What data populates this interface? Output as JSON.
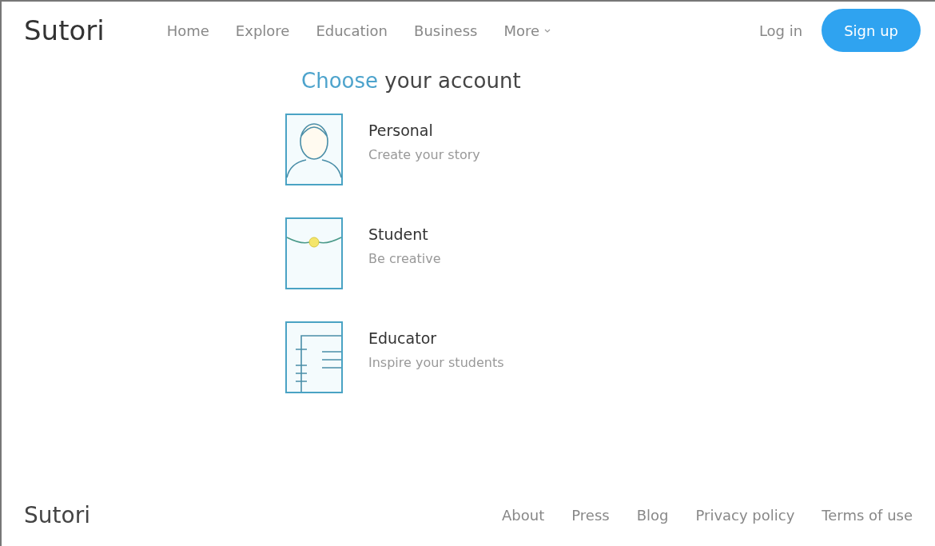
{
  "header": {
    "logo": "Sutori",
    "nav": [
      {
        "label": "Home",
        "kind": "link"
      },
      {
        "label": "Explore",
        "kind": "link"
      },
      {
        "label": "Education",
        "kind": "link"
      },
      {
        "label": "Business",
        "kind": "link"
      },
      {
        "label": "More",
        "kind": "dropdown"
      }
    ],
    "login": "Log in",
    "signup": "Sign up"
  },
  "heading": {
    "accent": "Choose",
    "rest": "your account"
  },
  "accounts": [
    {
      "kind": "personal",
      "title": "Personal",
      "subtitle": "Create your story"
    },
    {
      "kind": "student",
      "title": "Student",
      "subtitle": "Be creative"
    },
    {
      "kind": "educator",
      "title": "Educator",
      "subtitle": "Inspire your students"
    }
  ],
  "footer": {
    "logo": "Sutori",
    "links": [
      "About",
      "Press",
      "Blog",
      "Privacy policy",
      "Terms of use"
    ]
  }
}
